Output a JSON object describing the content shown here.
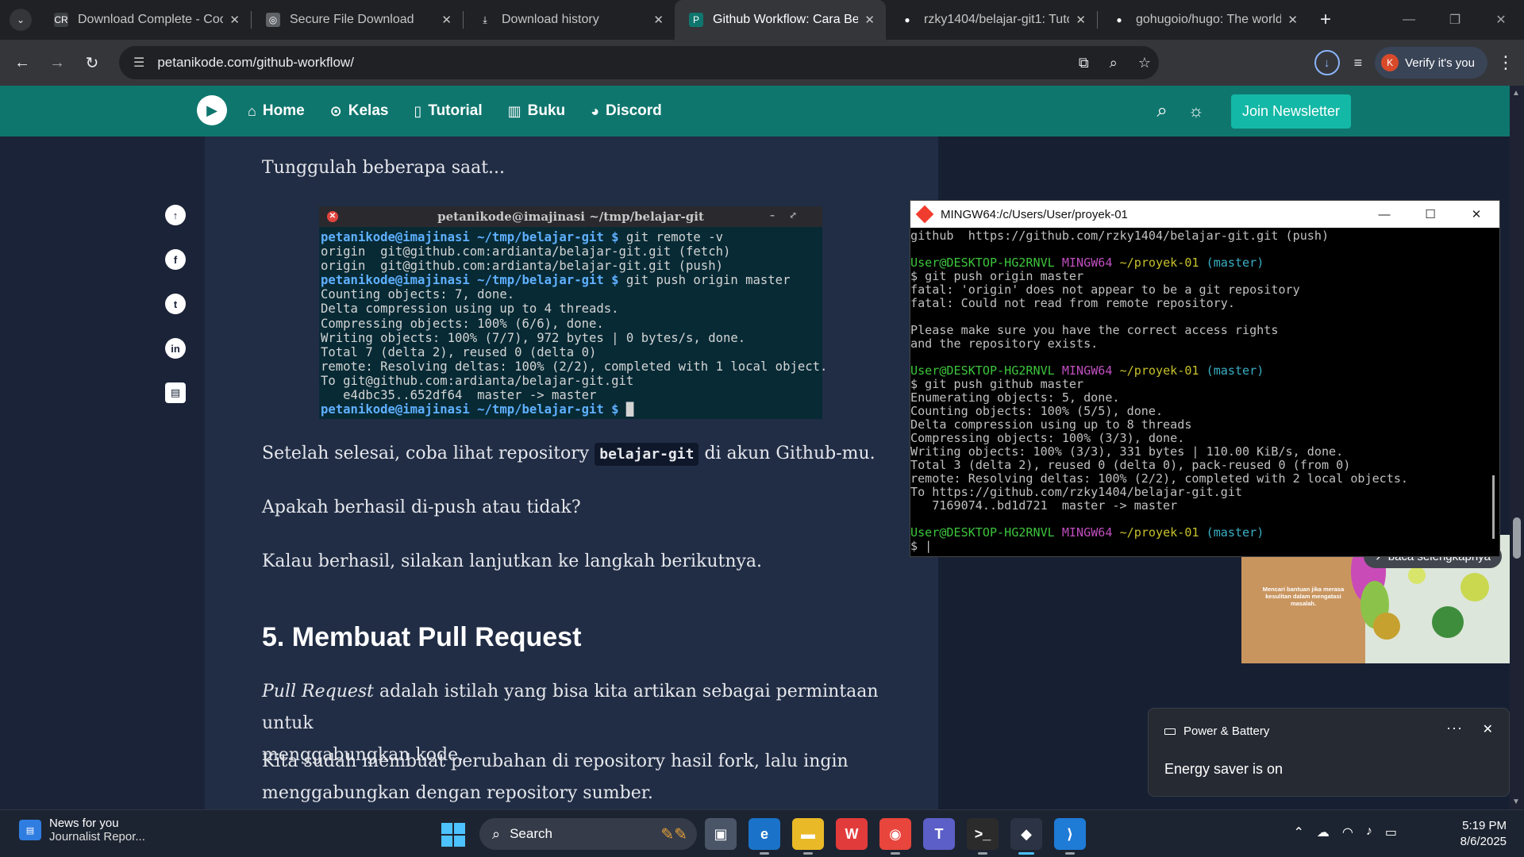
{
  "browser": {
    "tabs": [
      {
        "label": "Download Complete - Coo",
        "favicon": "CR",
        "favicon_color": "#3c4043",
        "active": false
      },
      {
        "label": "Secure File Download",
        "favicon": "◎",
        "favicon_color": "#5f6368",
        "active": false
      },
      {
        "label": "Download history",
        "favicon": "⤓",
        "favicon_color": "#202124",
        "active": false
      },
      {
        "label": "Github Workflow: Cara Ber",
        "favicon": "P",
        "favicon_color": "#0f766e",
        "active": true
      },
      {
        "label": "rzky1404/belajar-git1: Tuto",
        "favicon": "●",
        "favicon_color": "#202124",
        "active": false
      },
      {
        "label": "gohugoio/hugo: The world",
        "favicon": "●",
        "favicon_color": "#202124",
        "active": false
      }
    ],
    "url": "petanikode.com/github-workflow/",
    "verify_label": "Verify it's you",
    "verify_avatar": "K"
  },
  "site": {
    "nav": [
      "Home",
      "Kelas",
      "Tutorial",
      "Buku",
      "Discord"
    ],
    "nav_icons": [
      "home-icon",
      "play-circle-icon",
      "document-icon",
      "book-icon",
      "discord-icon"
    ],
    "join_label": "Join Newsletter"
  },
  "article": {
    "p1": "Tunggulah beberapa saat...",
    "terminal_title": "petanikode@imajinasi ~/tmp/belajar-git",
    "terminal_lines": [
      {
        "prompt": "petanikode@imajinasi ~/tmp/belajar-git $",
        "text": " git remote -v"
      },
      {
        "prompt": "",
        "text": "origin  git@github.com:ardianta/belajar-git.git (fetch)"
      },
      {
        "prompt": "",
        "text": "origin  git@github.com:ardianta/belajar-git.git (push)"
      },
      {
        "prompt": "petanikode@imajinasi ~/tmp/belajar-git $",
        "text": " git push origin master"
      },
      {
        "prompt": "",
        "text": "Counting objects: 7, done."
      },
      {
        "prompt": "",
        "text": "Delta compression using up to 4 threads."
      },
      {
        "prompt": "",
        "text": "Compressing objects: 100% (6/6), done."
      },
      {
        "prompt": "",
        "text": "Writing objects: 100% (7/7), 972 bytes | 0 bytes/s, done."
      },
      {
        "prompt": "",
        "text": "Total 7 (delta 2), reused 0 (delta 0)"
      },
      {
        "prompt": "",
        "text": "remote: Resolving deltas: 100% (2/2), completed with 1 local object."
      },
      {
        "prompt": "",
        "text": "To git@github.com:ardianta/belajar-git.git"
      },
      {
        "prompt": "",
        "text": "   e4dbc35..652df64  master -> master"
      },
      {
        "prompt": "petanikode@imajinasi ~/tmp/belajar-git $",
        "text": " █"
      }
    ],
    "p2_before": "Setelah selesai, coba lihat repository ",
    "p2_code": "belajar-git",
    "p2_after": " di akun Github-mu.",
    "p3": "Apakah berhasil di-push atau tidak?",
    "p4": "Kalau berhasil, silakan lanjutkan ke langkah berikutnya.",
    "h2": "5. Membuat Pull Request",
    "p5_em": "Pull Request",
    "p5_rest": " adalah istilah yang bisa kita artikan sebagai permintaan untuk",
    "p5_line2": "menggabungkan kode.",
    "p6": "Kita sudah membuat perubahan di repository hasil fork, lalu ingin",
    "p6_line2": "menggabungkan dengan repository sumber."
  },
  "ad": {
    "read_more": "↗ baca selengkapnya",
    "text": "Mencari bantuan jika merasa kesulitan dalam mengatasi masalah."
  },
  "mingw": {
    "title": "MINGW64:/c/Users/User/proyek-01",
    "lines": [
      {
        "c": "",
        "t": "github  https://github.com/rzky1404/belajar-git.git (push)"
      },
      {
        "c": "",
        "t": ""
      },
      {
        "c": "prompt",
        "u": "User@DESKTOP-HG2RNVL",
        "m": "MINGW64",
        "p": "~/proyek-01",
        "b": "(master)"
      },
      {
        "c": "",
        "t": "$ git push origin master"
      },
      {
        "c": "",
        "t": "fatal: 'origin' does not appear to be a git repository"
      },
      {
        "c": "",
        "t": "fatal: Could not read from remote repository."
      },
      {
        "c": "",
        "t": ""
      },
      {
        "c": "",
        "t": "Please make sure you have the correct access rights"
      },
      {
        "c": "",
        "t": "and the repository exists."
      },
      {
        "c": "",
        "t": ""
      },
      {
        "c": "prompt",
        "u": "User@DESKTOP-HG2RNVL",
        "m": "MINGW64",
        "p": "~/proyek-01",
        "b": "(master)"
      },
      {
        "c": "",
        "t": "$ git push github master"
      },
      {
        "c": "",
        "t": "Enumerating objects: 5, done."
      },
      {
        "c": "",
        "t": "Counting objects: 100% (5/5), done."
      },
      {
        "c": "",
        "t": "Delta compression using up to 8 threads"
      },
      {
        "c": "",
        "t": "Compressing objects: 100% (3/3), done."
      },
      {
        "c": "",
        "t": "Writing objects: 100% (3/3), 331 bytes | 110.00 KiB/s, done."
      },
      {
        "c": "",
        "t": "Total 3 (delta 2), reused 0 (delta 0), pack-reused 0 (from 0)"
      },
      {
        "c": "",
        "t": "remote: Resolving deltas: 100% (2/2), completed with 2 local objects."
      },
      {
        "c": "",
        "t": "To https://github.com/rzky1404/belajar-git.git"
      },
      {
        "c": "",
        "t": "   7169074..bd1d721  master -> master"
      },
      {
        "c": "",
        "t": ""
      },
      {
        "c": "prompt",
        "u": "User@DESKTOP-HG2RNVL",
        "m": "MINGW64",
        "p": "~/proyek-01",
        "b": "(master)"
      },
      {
        "c": "",
        "t": "$ |"
      }
    ]
  },
  "notification": {
    "app": "Power & Battery",
    "more": "···",
    "message": "Energy saver is on"
  },
  "taskbar": {
    "news_title": "News for you",
    "news_sub": "Journalist Repor...",
    "search_label": "Search",
    "apps": [
      {
        "name": "task-view",
        "glyph": "▣",
        "bg": "#4a5568"
      },
      {
        "name": "edge",
        "glyph": "e",
        "bg": "#1a73c9"
      },
      {
        "name": "file-explorer",
        "glyph": "▬",
        "bg": "#e9b928"
      },
      {
        "name": "wps-office",
        "glyph": "W",
        "bg": "#e23b3b"
      },
      {
        "name": "chrome",
        "glyph": "◉",
        "bg": "#e8453c"
      },
      {
        "name": "teams",
        "glyph": "T",
        "bg": "#5b5fc7"
      },
      {
        "name": "terminal",
        "glyph": ">_",
        "bg": "#2b2b2b"
      },
      {
        "name": "git-bash",
        "glyph": "◆",
        "bg": "#2c3344"
      },
      {
        "name": "vscode",
        "glyph": "⟩",
        "bg": "#1e7bd6"
      }
    ],
    "time": "5:19 PM",
    "date": "8/6/2025"
  }
}
